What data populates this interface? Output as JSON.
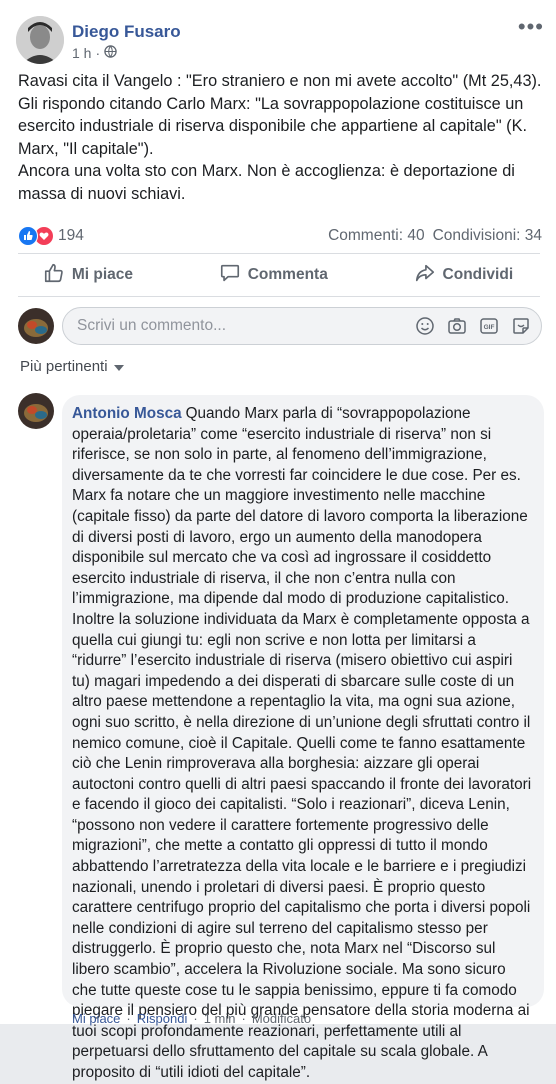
{
  "post": {
    "author": "Diego Fusaro",
    "time": "1 h",
    "separator": "·",
    "text_lines": [
      "Ravasi cita il Vangelo : \"Ero straniero e non mi avete accolto\" (Mt 25,43).",
      "Gli rispondo citando Carlo Marx: \"La sovrappopolazione costituisce un esercito industriale di riserva disponibile che appartiene al capitale\" (K. Marx, \"Il capitale\").",
      "Ancora una volta sto con Marx. Non è accoglienza: è deportazione di massa di nuovi schiavi."
    ],
    "reactions_count": "194",
    "comments_count": "Commenti: 40",
    "shares_count": "Condivisioni: 34"
  },
  "actions": {
    "like": "Mi piace",
    "comment": "Commenta",
    "share": "Condividi"
  },
  "composer": {
    "placeholder": "Scrivi un commento..."
  },
  "sort_label": "Più pertinenti",
  "comment": {
    "author": "Antonio Mosca",
    "text": "Quando Marx parla di “sovrappopolazione operaia/proletaria” come “esercito industriale di riserva” non si riferisce, se non solo in parte, al fenomeno dell’immigrazione, diversamente da te che vorresti far coincidere le due cose. Per es. Marx fa notare che un maggiore investimento nelle macchine (capitale fisso) da parte del datore di lavoro comporta la liberazione di diversi posti di lavoro, ergo un aumento della manodopera disponibile sul mercato che va così ad ingrossare il cosiddetto esercito industriale di riserva, il che non c’entra nulla con l’immigrazione, ma dipende dal modo di produzione capitalistico. Inoltre la soluzione individuata da Marx è completamente opposta a quella cui giungi tu: egli non scrive e non lotta per limitarsi a “ridurre” l’esercito industriale di riserva (misero obiettivo cui aspiri tu) magari impedendo a dei disperati di sbarcare sulle coste di un altro paese mettendone a repentaglio la vita, ma ogni sua azione, ogni suo scritto, è nella direzione di un’unione degli sfruttati contro il nemico comune, cioè il Capitale. Quelli come te fanno esattamente ciò che Lenin rimproverava alla borghesia: aizzare gli operai autoctoni contro quelli di altri paesi spaccando il fronte dei lavoratori e facendo il gioco dei capitalisti. “Solo i reazionari”, diceva Lenin, “possono non vedere il carattere fortemente progressivo delle migrazioni”, che mette a contatto gli oppressi di tutto il mondo abbattendo l’arretratezza della vita locale e le barriere e i pregiudizi nazionali, unendo i proletari di diversi paesi. È proprio questo carattere centrifugo proprio del capitalismo che porta i diversi popoli nelle condizioni di agire sul terreno del capitalismo stesso per distruggerlo. È proprio questo che, nota Marx nel “Discorso sul libero scambio”, accelera la Rivoluzione sociale. Ma sono sicuro che tutte queste cose tu le sappia benissimo, eppure ti fa comodo piegare il pensiero del più grande pensatore della storia moderna ai tuoi scopi profondamente reazionari, perfettamente utili al perpetuarsi dello sfruttamento del capitale su scala globale. A proposito di “utili idioti del capitale”.",
    "like": "Mi piace",
    "reply": "Rispondi",
    "time": "1 min",
    "edited": "Modificato",
    "dot": "·"
  },
  "colors": {
    "link_blue": "#385898",
    "like_blue": "#1877f2",
    "love_red": "#f33e58",
    "meta_gray": "#606770"
  },
  "icons": [
    "more-icon",
    "globe-icon",
    "like-reaction-icon",
    "love-reaction-icon",
    "thumbs-up-icon",
    "comment-icon",
    "share-icon",
    "emoji-icon",
    "camera-icon",
    "gif-icon",
    "sticker-icon",
    "caret-down-icon"
  ]
}
